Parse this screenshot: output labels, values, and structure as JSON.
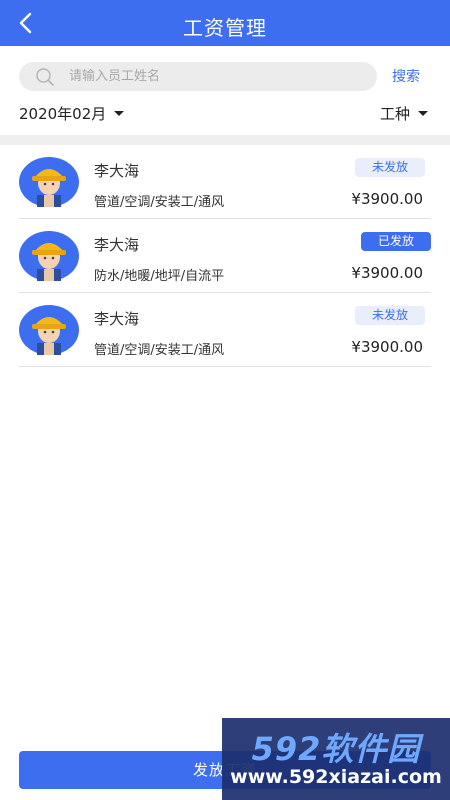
{
  "header": {
    "title": "工资管理"
  },
  "search": {
    "placeholder": "请输入员工姓名",
    "button_label": "搜索"
  },
  "filters": {
    "date": "2020年02月",
    "trade": "工种"
  },
  "workers": [
    {
      "name": "李大海",
      "trades": "管道/空调/安装工/通风",
      "status": "未发放",
      "salary": "¥3900.00"
    },
    {
      "name": "李大海",
      "trades": "防水/地暖/地坪/自流平",
      "status": "已发放",
      "salary": "¥3900.00"
    },
    {
      "name": "李大海",
      "trades": "管道/空调/安装工/通风",
      "status": "未发放",
      "salary": "¥3900.00"
    }
  ],
  "footer": {
    "pay_button_label": "发放工资"
  },
  "watermark": {
    "brand": "592软件园",
    "url": "www.592xiazai.com"
  },
  "colors": {
    "primary": "#3d6ef0",
    "badge_pending_bg": "#e8eefc",
    "divider": "#efefef"
  },
  "icons": {
    "back": "chevron-left-icon",
    "search": "search-icon",
    "dropdown": "caret-down-icon",
    "avatar": "worker-helmet-avatar"
  }
}
